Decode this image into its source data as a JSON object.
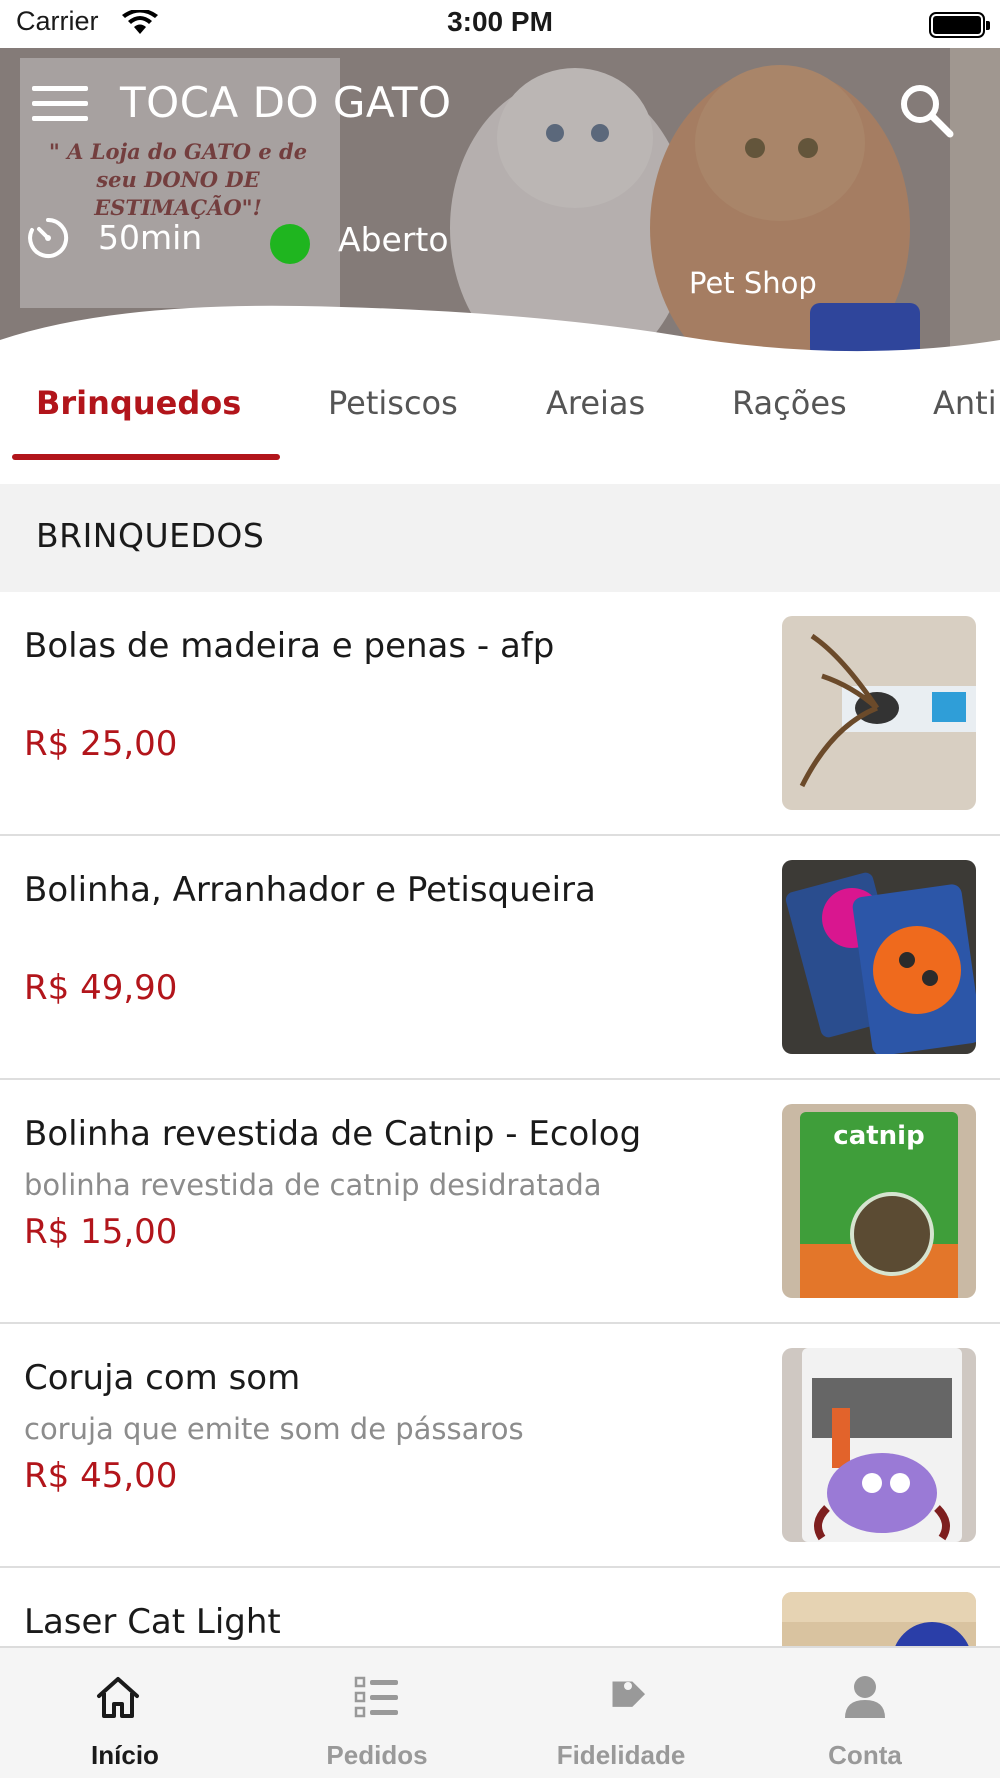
{
  "status_bar": {
    "carrier": "Carrier",
    "time": "3:00 PM"
  },
  "header": {
    "store_name": "TOCA DO GATO",
    "slogan": "\" A Loja do GATO e de seu DONO DE ESTIMAÇÃO\"!",
    "delivery_time": "50min",
    "status": "Aberto",
    "status_color": "#1fb51f",
    "category": "Pet Shop",
    "icons": {
      "menu": "hamburger-menu-icon",
      "search": "search-icon",
      "timer": "timer-icon"
    }
  },
  "tabs": [
    {
      "label": "Brinquedos",
      "active": true
    },
    {
      "label": "Petiscos",
      "active": false
    },
    {
      "label": "Areias",
      "active": false
    },
    {
      "label": "Rações",
      "active": false
    },
    {
      "label": "Anti",
      "active": false
    }
  ],
  "section": {
    "title": "BRINQUEDOS"
  },
  "products": [
    {
      "name": "Bolas de madeira e penas - afp",
      "description": "",
      "price": "R$ 25,00"
    },
    {
      "name": "Bolinha, Arranhador e Petisqueira",
      "description": "",
      "price": "R$ 49,90"
    },
    {
      "name": "Bolinha revestida de Catnip - Ecolog",
      "description": "bolinha revestida de catnip desidratada",
      "price": "R$ 15,00",
      "image_text": "catnip"
    },
    {
      "name": "Coruja com som",
      "description": "coruja que emite som de pássaros",
      "price": "R$ 45,00"
    },
    {
      "name": "Laser Cat Light",
      "description": "",
      "price": ""
    }
  ],
  "tabbar": [
    {
      "label": "Início",
      "icon": "home-icon",
      "active": true
    },
    {
      "label": "Pedidos",
      "icon": "orders-list-icon",
      "active": false
    },
    {
      "label": "Fidelidade",
      "icon": "loyalty-tag-icon",
      "active": false
    },
    {
      "label": "Conta",
      "icon": "account-icon",
      "active": false
    }
  ],
  "colors": {
    "accent": "#b2151b",
    "open_status": "#1fb51f",
    "section_bg": "#f2f2f2"
  }
}
